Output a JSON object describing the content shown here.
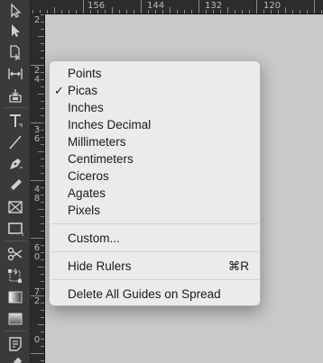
{
  "tools": [
    {
      "name": "selection-tool",
      "icon": "selection-arrow-icon"
    },
    {
      "name": "direct-selection-tool",
      "icon": "direct-selection-arrow-icon"
    },
    {
      "name": "page-tool",
      "icon": "page-icon"
    },
    {
      "name": "gap-tool",
      "icon": "gap-icon"
    },
    {
      "name": "content-collector-tool",
      "icon": "content-collector-icon"
    },
    {
      "name": "type-tool",
      "icon": "type-icon"
    },
    {
      "name": "line-tool",
      "icon": "line-icon"
    },
    {
      "name": "pen-tool",
      "icon": "pen-icon"
    },
    {
      "name": "pencil-tool",
      "icon": "pencil-icon"
    },
    {
      "name": "rectangle-frame-tool",
      "icon": "rectangle-frame-icon"
    },
    {
      "name": "rectangle-tool",
      "icon": "rectangle-icon"
    },
    {
      "name": "scissors-tool",
      "icon": "scissors-icon"
    },
    {
      "name": "free-transform-tool",
      "icon": "free-transform-icon"
    },
    {
      "name": "gradient-swatch-tool",
      "icon": "gradient-swatch-icon"
    },
    {
      "name": "gradient-feather-tool",
      "icon": "gradient-feather-icon"
    },
    {
      "name": "note-tool",
      "icon": "note-icon"
    },
    {
      "name": "eyedropper-tool",
      "icon": "eyedropper-icon"
    }
  ],
  "ruler_top": {
    "labels": [
      "156",
      "144",
      "132",
      "120"
    ]
  },
  "ruler_left": {
    "labels": [
      "2",
      "24",
      "36",
      "48",
      "60",
      "72",
      "0"
    ]
  },
  "menu": {
    "units": [
      {
        "label": "Points",
        "checked": false
      },
      {
        "label": "Picas",
        "checked": true
      },
      {
        "label": "Inches",
        "checked": false
      },
      {
        "label": "Inches Decimal",
        "checked": false
      },
      {
        "label": "Millimeters",
        "checked": false
      },
      {
        "label": "Centimeters",
        "checked": false
      },
      {
        "label": "Ciceros",
        "checked": false
      },
      {
        "label": "Agates",
        "checked": false
      },
      {
        "label": "Pixels",
        "checked": false
      }
    ],
    "check_glyph": "✓",
    "custom_label": "Custom...",
    "hide_rulers_label": "Hide Rulers",
    "hide_rulers_shortcut": "⌘R",
    "delete_guides_label": "Delete All Guides on Spread"
  },
  "colors": {
    "toolbar_bg": "#3a3a3a",
    "ruler_bg": "#2c2c2c",
    "menu_bg": "#ebebeb",
    "pasteboard": "#c9c9c9",
    "icon": "#cfcfcf"
  }
}
